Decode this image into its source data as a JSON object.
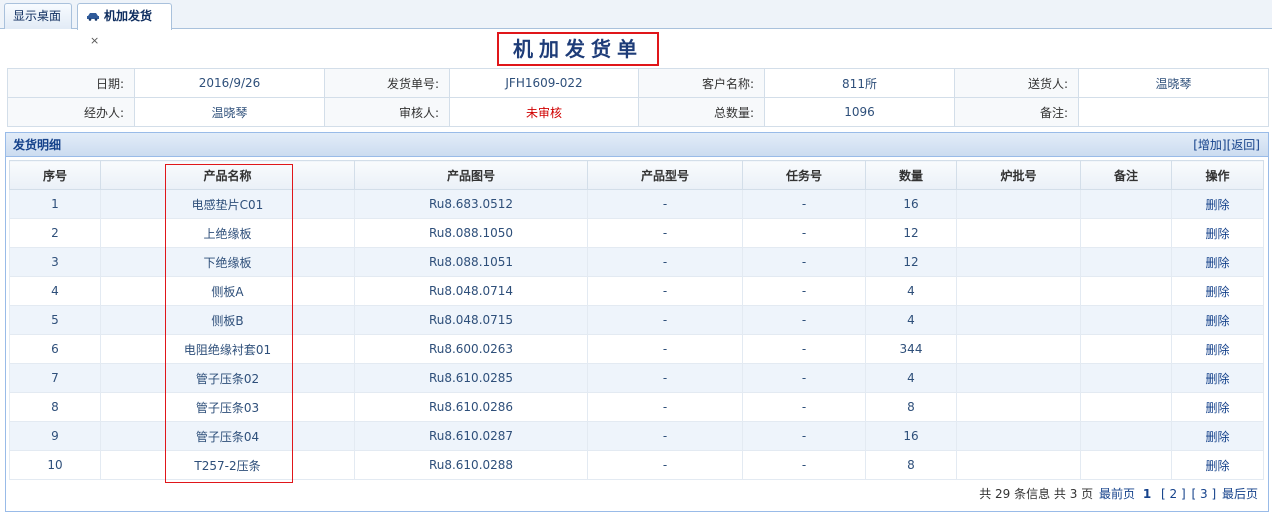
{
  "tabs": [
    {
      "label": "显示桌面"
    },
    {
      "label": "机加发货",
      "close": "×"
    }
  ],
  "page_title": "机加发货单",
  "header": {
    "date_label": "日期:",
    "date": "2016/9/26",
    "order_no_label": "发货单号:",
    "order_no": "JFH1609-022",
    "customer_label": "客户名称:",
    "customer": "811所",
    "sender_label": "送货人:",
    "sender": "温晓琴",
    "handler_label": "经办人:",
    "handler": "温晓琴",
    "reviewer_label": "审核人:",
    "reviewer": "未审核",
    "total_label": "总数量:",
    "total": "1096",
    "remark_label": "备注:",
    "remark": ""
  },
  "panel": {
    "title": "发货明细",
    "add_label": "[增加]",
    "back_label": "[返回]"
  },
  "columns": [
    "序号",
    "产品名称",
    "产品图号",
    "产品型号",
    "任务号",
    "数量",
    "炉批号",
    "备注",
    "操作"
  ],
  "rows": [
    {
      "no": "1",
      "name": "电感垫片C01",
      "drawing": "Ru8.683.0512",
      "model": "-",
      "task": "-",
      "qty": "16",
      "batch": "",
      "remark": "",
      "op": "删除"
    },
    {
      "no": "2",
      "name": "上绝缘板",
      "drawing": "Ru8.088.1050",
      "model": "-",
      "task": "-",
      "qty": "12",
      "batch": "",
      "remark": "",
      "op": "删除"
    },
    {
      "no": "3",
      "name": "下绝缘板",
      "drawing": "Ru8.088.1051",
      "model": "-",
      "task": "-",
      "qty": "12",
      "batch": "",
      "remark": "",
      "op": "删除"
    },
    {
      "no": "4",
      "name": "侧板A",
      "drawing": "Ru8.048.0714",
      "model": "-",
      "task": "-",
      "qty": "4",
      "batch": "",
      "remark": "",
      "op": "删除"
    },
    {
      "no": "5",
      "name": "侧板B",
      "drawing": "Ru8.048.0715",
      "model": "-",
      "task": "-",
      "qty": "4",
      "batch": "",
      "remark": "",
      "op": "删除"
    },
    {
      "no": "6",
      "name": "电阻绝缘衬套01",
      "drawing": "Ru8.600.0263",
      "model": "-",
      "task": "-",
      "qty": "344",
      "batch": "",
      "remark": "",
      "op": "删除"
    },
    {
      "no": "7",
      "name": "管子压条02",
      "drawing": "Ru8.610.0285",
      "model": "-",
      "task": "-",
      "qty": "4",
      "batch": "",
      "remark": "",
      "op": "删除"
    },
    {
      "no": "8",
      "name": "管子压条03",
      "drawing": "Ru8.610.0286",
      "model": "-",
      "task": "-",
      "qty": "8",
      "batch": "",
      "remark": "",
      "op": "删除"
    },
    {
      "no": "9",
      "name": "管子压条04",
      "drawing": "Ru8.610.0287",
      "model": "-",
      "task": "-",
      "qty": "16",
      "batch": "",
      "remark": "",
      "op": "删除"
    },
    {
      "no": "10",
      "name": "T257-2压条",
      "drawing": "Ru8.610.0288",
      "model": "-",
      "task": "-",
      "qty": "8",
      "batch": "",
      "remark": "",
      "op": "删除"
    }
  ],
  "pager": {
    "summary": "共 29 条信息  共 3 页",
    "first": "最前页",
    "current": "1",
    "page2": "[ 2 ]",
    "page3": "[ 3 ]",
    "last": "最后页"
  },
  "colors": {
    "highlight": "#e0161a",
    "title": "#1e3c78",
    "link": "#15428b",
    "unreviewed": "#d00000"
  }
}
